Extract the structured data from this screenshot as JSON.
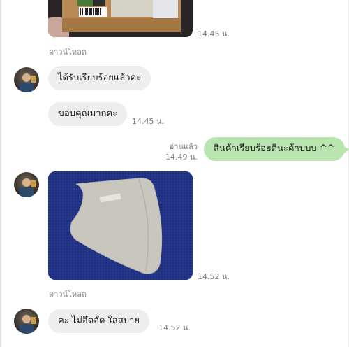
{
  "chat": {
    "package_photo": {
      "time": "14.45 น.",
      "download": "ดาวน์โหลด"
    },
    "msg_received_1": {
      "text": "ได้รับเรียบร้อยแล้วคะ"
    },
    "msg_received_2": {
      "text": "ขอบคุณมากคะ",
      "time": "14.45 น."
    },
    "msg_sent_1": {
      "read": "อ่านแล้ว",
      "time": "14.49 น.",
      "text": "สินค้าเรียบร้อยดีนะค้าบบบ ^^"
    },
    "mask_photo": {
      "time": "14.52 น.",
      "download": "ดาวน์โหลด"
    },
    "msg_received_3": {
      "text": "คะ ไม่อึดอัด ใส่สบาย",
      "time": "14.52 น."
    }
  },
  "colors": {
    "sent_bubble": "#b9e6b0",
    "received_bubble": "#eeeeee",
    "photo_background": "#1f2f7a"
  }
}
